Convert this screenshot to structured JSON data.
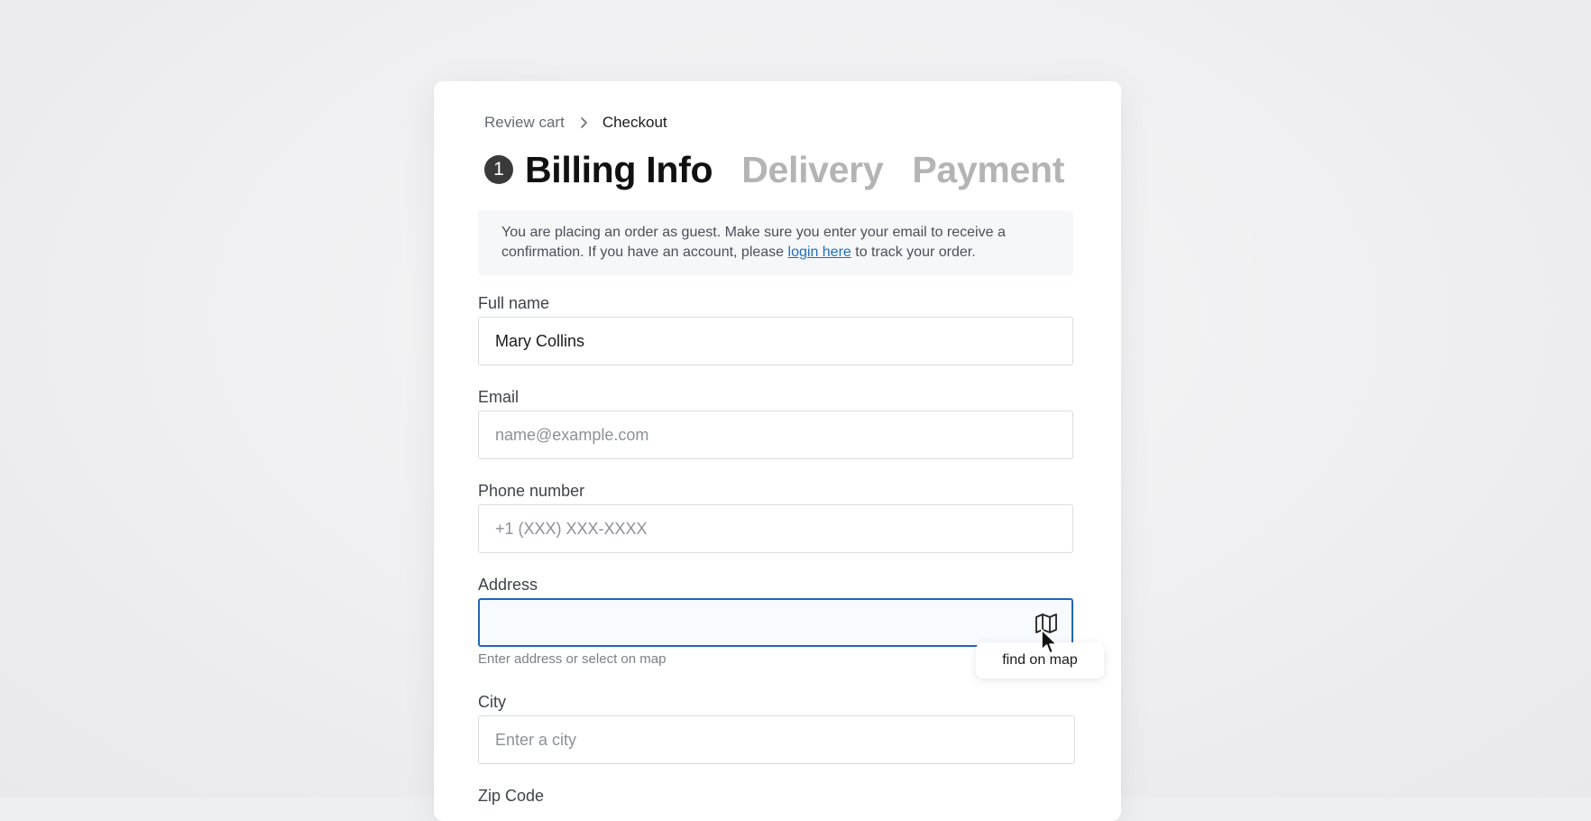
{
  "breadcrumb": {
    "items": [
      "Review cart",
      "Checkout"
    ]
  },
  "steps": {
    "active_number": "1",
    "items": [
      "Billing Info",
      "Delivery",
      "Payment"
    ]
  },
  "notice": {
    "text_before": "You are placing an order as guest. Make sure you enter your email to receive a confirmation. If you have an account, please ",
    "link_text": "login here",
    "text_after": " to track your order."
  },
  "form": {
    "full_name": {
      "label": "Full name",
      "value": "Mary Collins"
    },
    "email": {
      "label": "Email",
      "placeholder": "name@example.com"
    },
    "phone": {
      "label": "Phone number",
      "placeholder": "+1 (XXX) XXX-XXXX"
    },
    "address": {
      "label": "Address",
      "value": "",
      "helper": "Enter address or select on map",
      "map_icon": "map-icon"
    },
    "city": {
      "label": "City",
      "placeholder": "Enter a city"
    },
    "zip": {
      "label": "Zip Code"
    }
  },
  "tooltip": {
    "text": "find on map"
  },
  "colors": {
    "accent": "#2166b5",
    "link": "#1f6fb8",
    "inactive_step": "#b4b4b4"
  }
}
